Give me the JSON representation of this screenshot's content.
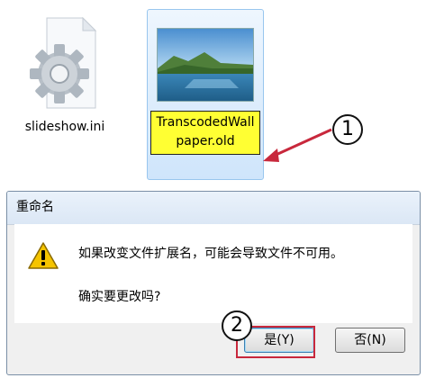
{
  "files": {
    "file1": {
      "name": "slideshow.ini",
      "icon": "gear-file-icon"
    },
    "file2": {
      "name_line1": "TranscodedWall",
      "name_line2": "paper.old",
      "icon": "landscape-thumbnail-icon"
    }
  },
  "callouts": {
    "one": "1",
    "two": "2"
  },
  "dialog": {
    "title": "重命名",
    "message": "如果改变文件扩展名，可能会导致文件不可用。",
    "question": "确实要更改吗?",
    "yes_label": "是(Y)",
    "no_label": "否(N)"
  },
  "colors": {
    "rename_highlight": "#ffff33",
    "callout_arrow": "#c8283c",
    "yes_highlight": "#c8283c"
  }
}
